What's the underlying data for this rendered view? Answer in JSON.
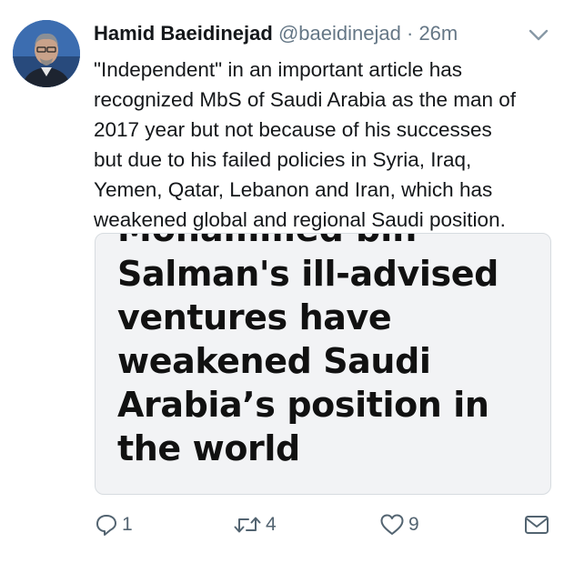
{
  "author": {
    "name": "Hamid Baeidinejad",
    "handle": "@baeidinejad",
    "separator": "·",
    "time": "26m"
  },
  "tweet": {
    "text": "\"Independent\" in an important article has\nrecognized MbS of Saudi Arabia as the man of\n2017 year but not because of his successes\nbut due to his failed policies in Syria, Iraq,\nYemen, Qatar, Lebanon and Iran, which has\nweakened global and regional Saudi position."
  },
  "card": {
    "headline_cut": "Mohammed bin",
    "headline": "Salman's ill-advised ventures have weakened Saudi Arabia’s position in the world"
  },
  "actions": {
    "reply_count": "1",
    "retweet_count": "4",
    "like_count": "9"
  },
  "icons": {
    "avatar": "avatar-photo",
    "menu": "chevron-down-icon",
    "reply": "reply-icon",
    "retweet": "retweet-icon",
    "like": "heart-icon",
    "dm": "envelope-icon"
  },
  "colors": {
    "text": "#14171a",
    "secondary": "#657786",
    "card_bg": "#f2f3f5",
    "card_border": "#d7dce0"
  }
}
